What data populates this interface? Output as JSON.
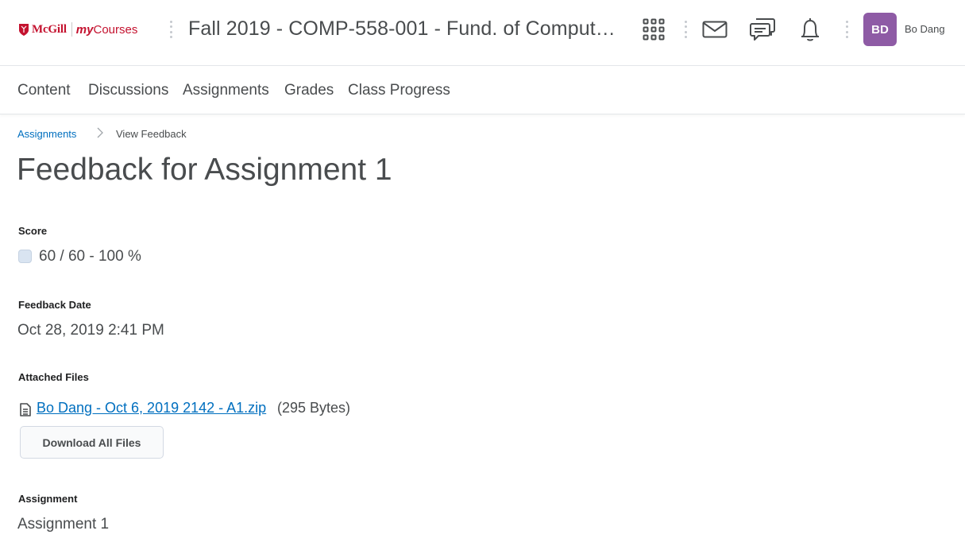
{
  "header": {
    "logo_brand": "McGill",
    "logo_my": "my",
    "logo_courses": "Courses",
    "course_title": "Fall 2019 - COMP-558-001 - Fund. of Comput…",
    "icons": [
      "apps-grid-icon",
      "mail-icon",
      "chat-icon",
      "bell-icon"
    ],
    "user_initials": "BD",
    "user_name": "Bo Dang",
    "avatar_color": "#8e5ba5",
    "brand_color": "#c4122f"
  },
  "nav": {
    "items": [
      "Content",
      "Discussions",
      "Assignments",
      "Grades",
      "Class Progress"
    ]
  },
  "breadcrumb": {
    "parent": "Assignments",
    "current": "View Feedback"
  },
  "page": {
    "title": "Feedback for Assignment 1",
    "score_label": "Score",
    "score_value": "60 / 60 - 100 %",
    "feedback_date_label": "Feedback Date",
    "feedback_date_value": "Oct 28, 2019 2:41 PM",
    "attached_files_label": "Attached Files",
    "file_name": "Bo Dang - Oct 6, 2019 2142 - A1.zip",
    "file_size": "(295 Bytes)",
    "download_button": "Download All Files",
    "assignment_label": "Assignment",
    "assignment_value": "Assignment 1"
  },
  "link_color": "#006fbf"
}
